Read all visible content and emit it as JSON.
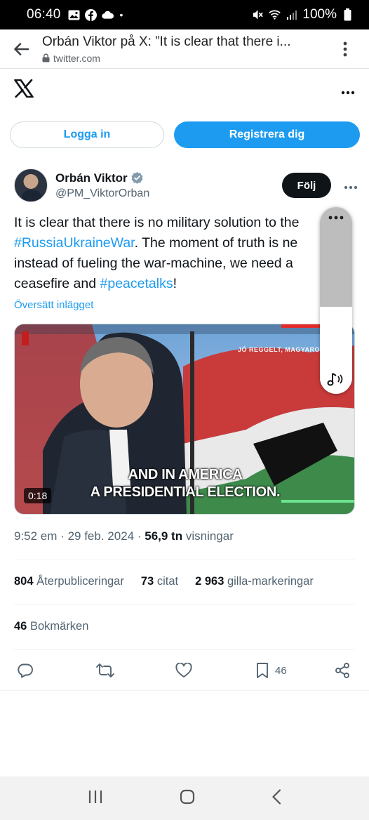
{
  "status_bar": {
    "time": "06:40",
    "battery": "100%",
    "dot": "•"
  },
  "browser": {
    "page_title": "Orbán Viktor på X: ”It is clear that there i...",
    "url": "twitter.com"
  },
  "auth": {
    "login_label": "Logga in",
    "signup_label": "Registrera dig"
  },
  "author": {
    "name": "Orbán Viktor",
    "handle": "@PM_ViktorOrban",
    "follow_label": "Följ"
  },
  "tweet": {
    "line1": "It is clear that there is no military solution to the",
    "line2_hashtag": "#RussiaUkraineWar",
    "line2_text": ". The moment of truth is ne",
    "line3": "instead of fueling the war-machine, we need a",
    "line4_text": "ceasefire and ",
    "line4_hashtag": "#peacetalks",
    "line4_end": "!",
    "translate_label": "Översätt inlägget"
  },
  "media": {
    "caption_line1": "AND IN AMERICA",
    "caption_line2": "A PRESIDENTIAL ELECTION.",
    "duration": "0:18",
    "channel_text": "JÓ REGGELT, MAGYARORSZ"
  },
  "meta": {
    "time": "9:52 em",
    "separator": "·",
    "date": "29 feb. 2024",
    "views_value": "56,9 tn",
    "views_label": "visningar"
  },
  "stats": {
    "reposts_value": "804",
    "reposts_label": "Återpubliceringar",
    "quotes_value": "73",
    "quotes_label": "citat",
    "likes_value": "2 963",
    "likes_label": "gilla-markeringar",
    "bookmarks_value": "46",
    "bookmarks_label": "Bokmärken"
  },
  "actions": {
    "bookmark_count": "46"
  },
  "colors": {
    "accent": "#1d9bf0",
    "text": "#0f1419",
    "muted": "#536471"
  },
  "icons": [
    "back-arrow-icon",
    "lock-icon",
    "kebab-menu-icon",
    "x-logo-icon",
    "verified-badge-icon",
    "reply-icon",
    "repost-icon",
    "like-icon",
    "bookmark-icon",
    "share-icon",
    "sound-icon"
  ]
}
